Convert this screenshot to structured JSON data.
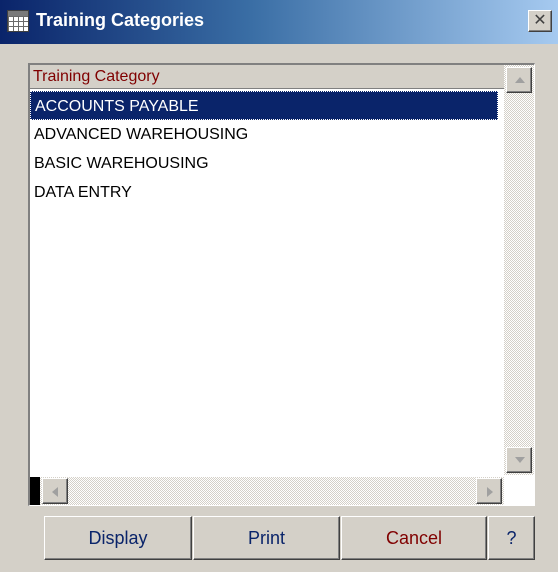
{
  "window": {
    "title": "Training Categories",
    "close_glyph": "✕"
  },
  "list": {
    "column_header": "Training Category",
    "items": [
      "ACCOUNTS PAYABLE",
      "ADVANCED WAREHOUSING",
      "BASIC WAREHOUSING",
      "DATA ENTRY"
    ],
    "selected_index": 0
  },
  "buttons": {
    "display": "Display",
    "print": "Print",
    "cancel": "Cancel",
    "help": "?"
  },
  "colors": {
    "title_start": "#0a246a",
    "title_end": "#a6caf0",
    "selection": "#0a246a",
    "header_text": "#800000",
    "button_text": "#0a246a",
    "cancel_text": "#800000"
  },
  "icons": {
    "app": "grid-window-icon",
    "close": "close-icon",
    "scroll_up": "arrow-up-icon",
    "scroll_down": "arrow-down-icon",
    "scroll_left": "arrow-left-icon",
    "scroll_right": "arrow-right-icon"
  }
}
